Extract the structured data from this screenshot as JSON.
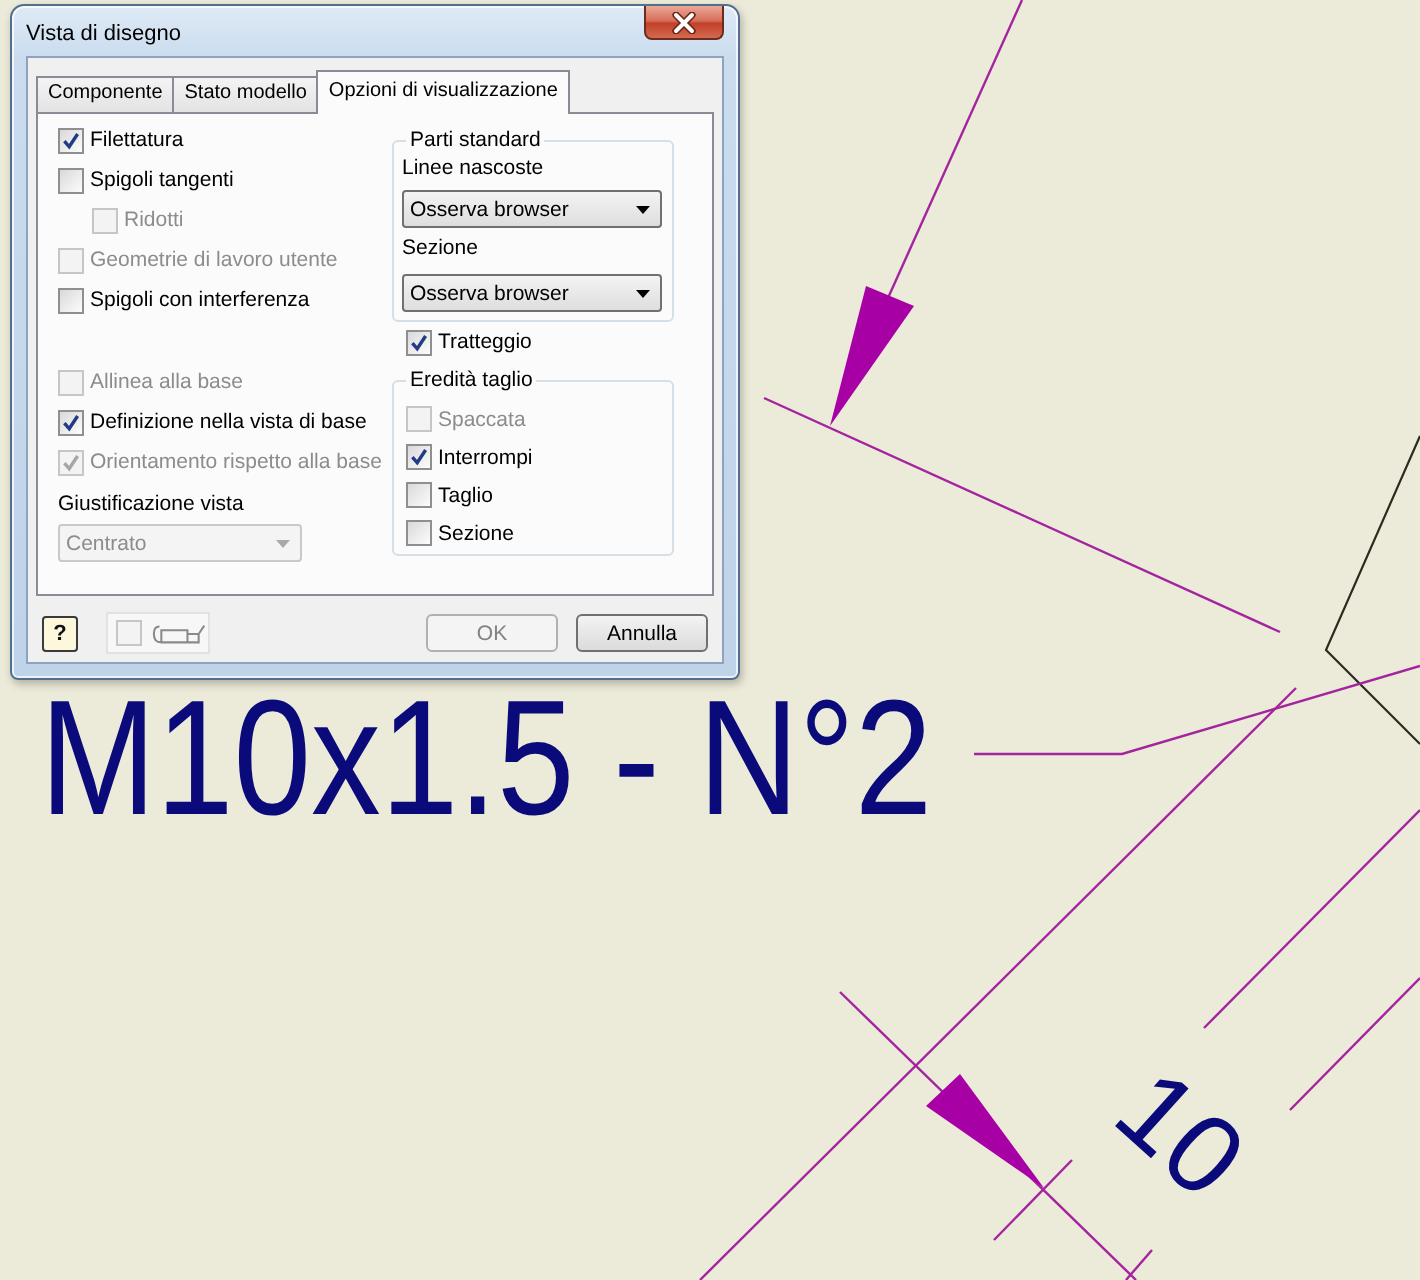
{
  "window": {
    "title": "Vista di disegno"
  },
  "tabs": [
    {
      "label": "Componente",
      "selected": false
    },
    {
      "label": "Stato modello",
      "selected": false
    },
    {
      "label": "Opzioni di visualizzazione",
      "selected": true
    }
  ],
  "display_options": [
    {
      "label": "Filettatura",
      "checked": true,
      "disabled": false
    },
    {
      "label": "Spigoli tangenti",
      "checked": false,
      "disabled": false,
      "children": [
        {
          "label": "Ridotti",
          "checked": false,
          "disabled": true
        }
      ]
    },
    {
      "label": "Geometrie di lavoro utente",
      "checked": false,
      "disabled": true
    },
    {
      "label": "Spigoli con interferenza",
      "checked": false,
      "disabled": false
    }
  ],
  "base_options": [
    {
      "label": "Allinea alla base",
      "checked": false,
      "disabled": true
    },
    {
      "label": "Definizione nella vista di base",
      "checked": true,
      "disabled": false
    },
    {
      "label": "Orientamento rispetto alla base",
      "checked": true,
      "disabled": true
    }
  ],
  "view_justification": {
    "label": "Giustificazione vista",
    "value": "Centrato",
    "disabled": true
  },
  "standard_parts": {
    "title": "Parti standard",
    "fields": [
      {
        "label": "Linee nascoste",
        "value": "Osserva browser",
        "disabled": false
      },
      {
        "label": "Sezione",
        "value": "Osserva browser",
        "disabled": false
      }
    ]
  },
  "hatching": {
    "label": "Tratteggio",
    "checked": true,
    "disabled": false
  },
  "section_inheritance": {
    "title": "Eredità taglio",
    "options": [
      {
        "label": "Spaccata",
        "checked": false,
        "disabled": true
      },
      {
        "label": "Interrompi",
        "checked": true,
        "disabled": false
      },
      {
        "label": "Taglio",
        "checked": false,
        "disabled": false
      },
      {
        "label": "Sezione",
        "checked": false,
        "disabled": false
      }
    ]
  },
  "footer": {
    "help": "?",
    "toggle": {
      "checked": false,
      "disabled": true
    },
    "buttons": [
      {
        "label": "OK",
        "disabled": true
      },
      {
        "label": "Annulla",
        "disabled": false
      }
    ]
  },
  "drawing": {
    "thread_note": "M10x1.5 - N°2",
    "dimension": "10"
  }
}
